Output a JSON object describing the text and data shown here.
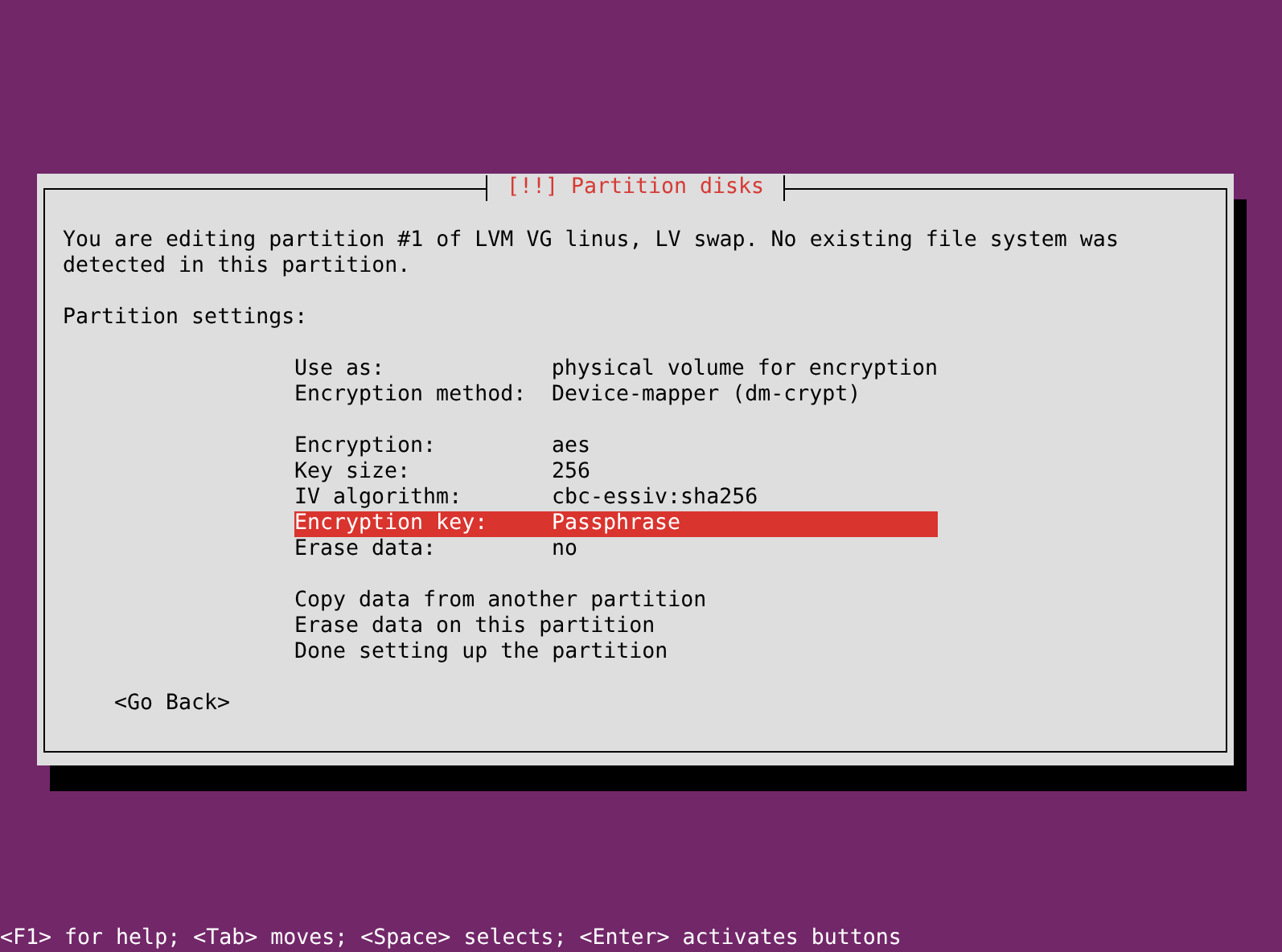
{
  "dialog": {
    "title": "[!!] Partition disks",
    "intro": "You are editing partition #1 of LVM VG linus, LV swap. No existing file system was detected in this partition.",
    "settings_heading": "Partition settings:",
    "groups": [
      [
        {
          "label": "Use as:",
          "value": "physical volume for encryption",
          "selected": false
        },
        {
          "label": "Encryption method:",
          "value": "Device-mapper (dm-crypt)",
          "selected": false
        }
      ],
      [
        {
          "label": "Encryption:",
          "value": "aes",
          "selected": false
        },
        {
          "label": "Key size:",
          "value": "256",
          "selected": false
        },
        {
          "label": "IV algorithm:",
          "value": "cbc-essiv:sha256",
          "selected": false
        },
        {
          "label": "Encryption key:",
          "value": "Passphrase",
          "selected": true
        },
        {
          "label": "Erase data:",
          "value": "no",
          "selected": false
        }
      ],
      [
        {
          "label": "Copy data from another partition",
          "selected": false
        },
        {
          "label": "Erase data on this partition",
          "selected": false
        },
        {
          "label": "Done setting up the partition",
          "selected": false
        }
      ]
    ],
    "back_button": "<Go Back>"
  },
  "status_bar": "<F1> for help; <Tab> moves; <Space> selects; <Enter> activates buttons"
}
